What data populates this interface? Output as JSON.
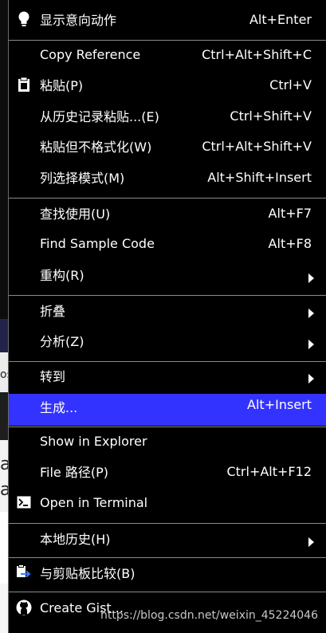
{
  "background": {
    "left_glyphs": [
      "os",
      "a",
      "a"
    ]
  },
  "menu": {
    "items": [
      {
        "label": "显示意向动作",
        "shortcut": "Alt+Enter",
        "icon": "lightbulb-icon"
      },
      {
        "label": "Copy Reference",
        "shortcut": "Ctrl+Alt+Shift+C"
      },
      {
        "label": "粘贴(P)",
        "shortcut": "Ctrl+V",
        "icon": "clipboard-icon"
      },
      {
        "label": "从历史记录粘贴...(E)",
        "shortcut": "Ctrl+Shift+V"
      },
      {
        "label": "粘贴但不格式化(W)",
        "shortcut": "Ctrl+Alt+Shift+V"
      },
      {
        "label": "列选择模式(M)",
        "shortcut": "Alt+Shift+Insert"
      },
      {
        "label": "查找使用(U)",
        "shortcut": "Alt+F7"
      },
      {
        "label": "Find Sample Code",
        "shortcut": "Alt+F8"
      },
      {
        "label": "重构(R)",
        "submenu": true
      },
      {
        "label": "折叠",
        "submenu": true
      },
      {
        "label": "分析(Z)",
        "submenu": true
      },
      {
        "label": "转到",
        "submenu": true
      },
      {
        "label": "生成...",
        "shortcut": "Alt+Insert",
        "selected": true
      },
      {
        "label": "Show in Explorer"
      },
      {
        "label": "File 路径(P)",
        "shortcut": "Ctrl+Alt+F12"
      },
      {
        "label": "Open in Terminal",
        "icon": "terminal-icon"
      },
      {
        "label": "本地历史(H)",
        "submenu": true
      },
      {
        "label": "与剪贴板比较(B)",
        "icon": "compare-clipboard-icon"
      },
      {
        "label": "Create Gist...",
        "icon": "github-icon"
      }
    ]
  },
  "watermark": "https://blog.csdn.net/weixin_45224046",
  "colors": {
    "menu_bg": "#000000",
    "selected_bg": "#3333ff",
    "separator": "#8a8a8a",
    "text": "#ffffff"
  }
}
